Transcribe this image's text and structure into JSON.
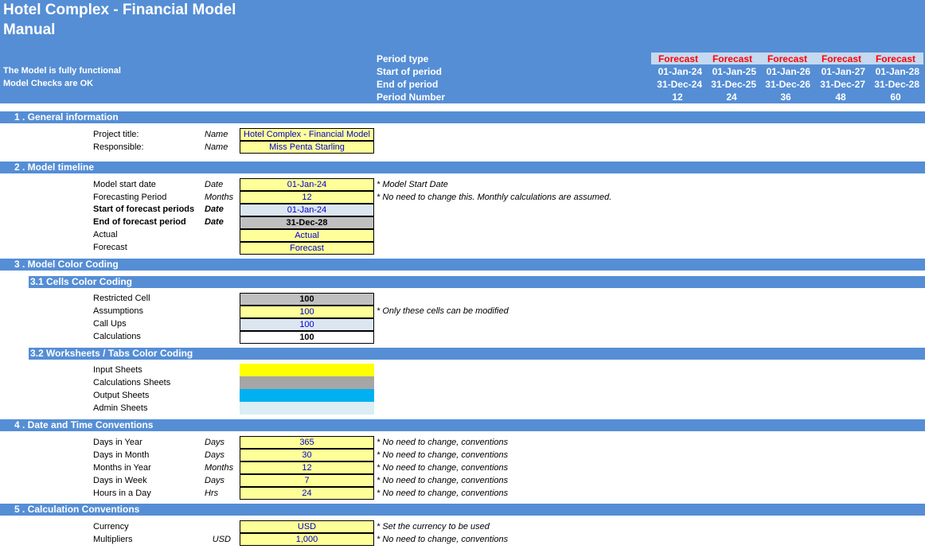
{
  "header": {
    "title1": "Hotel Complex - Financial Model",
    "title2": "Manual",
    "status1": "The Model is fully functional",
    "status2": "Model Checks are OK",
    "row_labels": [
      "Period type",
      "Start of period",
      "End of period",
      "Period Number"
    ],
    "periods": [
      {
        "type": "Forecast",
        "start": "01-Jan-24",
        "end": "31-Dec-24",
        "number": "12"
      },
      {
        "type": "Forecast",
        "start": "01-Jan-25",
        "end": "31-Dec-25",
        "number": "24"
      },
      {
        "type": "Forecast",
        "start": "01-Jan-26",
        "end": "31-Dec-26",
        "number": "36"
      },
      {
        "type": "Forecast",
        "start": "01-Jan-27",
        "end": "31-Dec-27",
        "number": "48"
      },
      {
        "type": "Forecast",
        "start": "01-Jan-28",
        "end": "31-Dec-28",
        "number": "60"
      }
    ]
  },
  "sections": {
    "s1": "1 .  General information",
    "s2": "2 .  Model timeline",
    "s3": "3 .  Model Color Coding",
    "s31": "3.1 Cells Color Coding",
    "s32": "3.2 Worksheets / Tabs Color Coding",
    "s4": "4 .  Date and Time Conventions",
    "s5": "5 .  Calculation Conventions"
  },
  "general": {
    "project_label": "Project title:",
    "project_unit": "Name",
    "project_value": "Hotel Complex - Financial Model",
    "resp_label": "Responsible:",
    "resp_unit": "Name",
    "resp_value": "Miss Penta Starling"
  },
  "timeline": {
    "start_label": "Model start date",
    "start_unit": "Date",
    "start_value": "01-Jan-24",
    "start_note": "* Model Start Date",
    "fp_label": "Forecasting Period",
    "fp_unit": "Months",
    "fp_value": "12",
    "fp_note": "* No need to change this. Monthly calculations are assumed.",
    "sfp_label": "Start of forecast periods",
    "sfp_unit": "Date",
    "sfp_value": "01-Jan-24",
    "efp_label": "End of forecast period",
    "efp_unit": "Date",
    "efp_value": "31-Dec-28",
    "actual_label": "Actual",
    "actual_value": "Actual",
    "forecast_label": "Forecast",
    "forecast_value": "Forecast"
  },
  "cells": {
    "restricted_label": "Restricted Cell",
    "restricted_value": "100",
    "assump_label": "Assumptions",
    "assump_value": "100",
    "assump_note": "* Only these cells can be modified",
    "callups_label": "Call Ups",
    "callups_value": "100",
    "calc_label": "Calculations",
    "calc_value": "100"
  },
  "sheets": {
    "input": "Input Sheets",
    "calc": "Calculations Sheets",
    "output": "Output Sheets",
    "admin": "Admin Sheets",
    "colors": {
      "input": "#FFFF00",
      "calc": "#A6A6A6",
      "output": "#00B0F0",
      "admin": "#DAEEF3"
    }
  },
  "conventions": {
    "note": "* No need to change, conventions",
    "rows": [
      {
        "label": "Days in Year",
        "unit": "Days",
        "value": "365"
      },
      {
        "label": "Days in Month",
        "unit": "Days",
        "value": "30"
      },
      {
        "label": "Months in Year",
        "unit": "Months",
        "value": "12"
      },
      {
        "label": "Days in Week",
        "unit": "Days",
        "value": "7"
      },
      {
        "label": "Hours in a Day",
        "unit": "Hrs",
        "value": "24"
      }
    ]
  },
  "calc": {
    "currency_label": "Currency",
    "currency_value": "USD",
    "currency_note": "* Set the currency to be used",
    "mult_label": "Multipliers",
    "mult_unit": "USD",
    "mult_value": "1,000",
    "mult_note": "* No need to change, conventions"
  }
}
